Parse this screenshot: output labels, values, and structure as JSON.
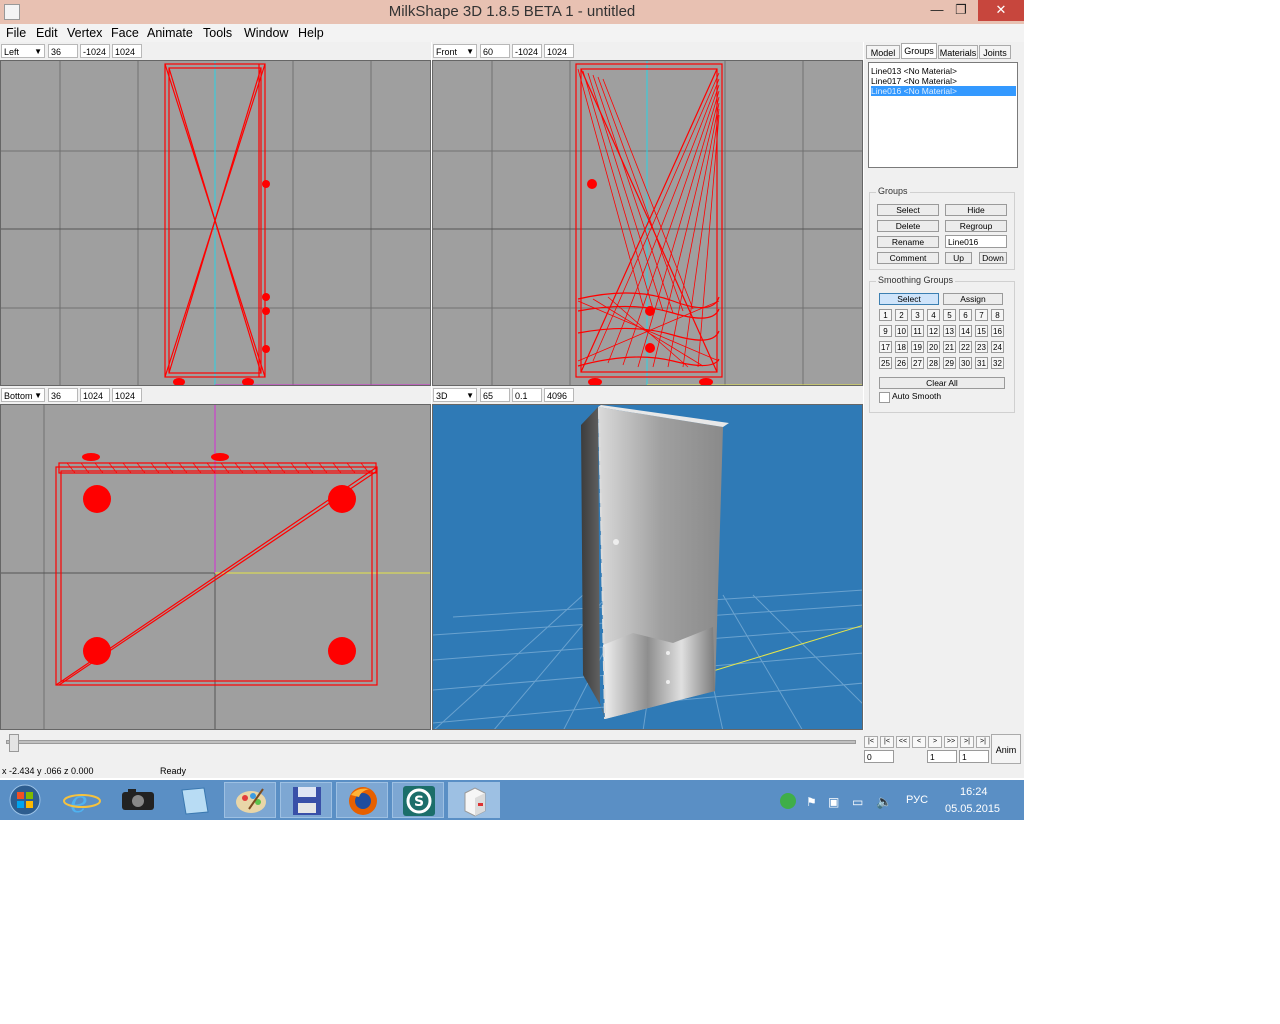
{
  "window": {
    "title": "MilkShape 3D 1.8.5 BETA 1 - untitled",
    "minimize": "—",
    "maximize": "❐",
    "close": "✕"
  },
  "menu": [
    "File",
    "Edit",
    "Vertex",
    "Face",
    "Animate",
    "Tools",
    "Window",
    "Help"
  ],
  "viewports": {
    "left": {
      "view": "Left",
      "v1": "36",
      "v2": "-1024",
      "v3": "1024"
    },
    "front": {
      "view": "Front",
      "v1": "60",
      "v2": "-1024",
      "v3": "1024"
    },
    "bottom": {
      "view": "Bottom",
      "v1": "36",
      "v2": "1024",
      "v3": "1024"
    },
    "persp": {
      "view": "3D",
      "v1": "65",
      "v2": "0.1",
      "v3": "4096"
    }
  },
  "tabs": [
    "Model",
    "Groups",
    "Materials",
    "Joints"
  ],
  "active_tab": "Groups",
  "groups_list": [
    {
      "label": "Line013 <No Material>",
      "selected": false
    },
    {
      "label": "Line017 <No Material>",
      "selected": false
    },
    {
      "label": "Line016 <No Material>",
      "selected": true
    }
  ],
  "groups_panel": {
    "legend": "Groups",
    "select": "Select",
    "hide": "Hide",
    "delete": "Delete",
    "regroup": "Regroup",
    "rename": "Rename",
    "name_value": "Line016",
    "comment": "Comment",
    "up": "Up",
    "down": "Down"
  },
  "smoothing_panel": {
    "legend": "Smoothing Groups",
    "select": "Select",
    "assign": "Assign",
    "numbers": [
      "1",
      "2",
      "3",
      "4",
      "5",
      "6",
      "7",
      "8",
      "9",
      "10",
      "11",
      "12",
      "13",
      "14",
      "15",
      "16",
      "17",
      "18",
      "19",
      "20",
      "21",
      "22",
      "23",
      "24",
      "25",
      "26",
      "27",
      "28",
      "29",
      "30",
      "31",
      "32"
    ],
    "clear_all": "Clear All",
    "auto_smooth": "Auto Smooth"
  },
  "anim": {
    "label": "Anim",
    "frame_start": "0",
    "frame_cur": "1",
    "frame_end": "1"
  },
  "status": {
    "coords": "x -2.434 y .066 z 0.000",
    "message": "Ready"
  },
  "taskbar": {
    "apps": [
      "start-button",
      "ie-icon",
      "camera-icon",
      "notepad-icon",
      "paint-icon",
      "save-disk-icon",
      "firefox-icon",
      "3dsmax-icon",
      "milkshape-icon"
    ],
    "language": "РУС",
    "time": "16:24",
    "date": "05.05.2015"
  },
  "colors": {
    "wireframe": "#ff0000",
    "viewport_bg": "#9f9f9f",
    "perspective_bg": "#2f7ab6",
    "selection": "#3399ff",
    "taskbar": "#5a8fc5"
  }
}
